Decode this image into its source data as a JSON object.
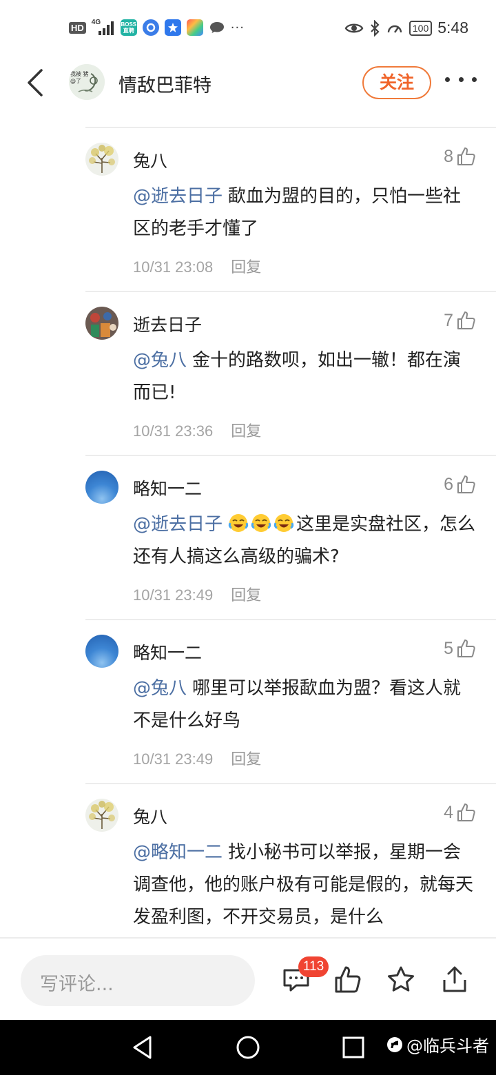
{
  "status_bar": {
    "hd": "HD",
    "network": "4G",
    "app_boss_line1": "BOSS",
    "app_boss_line2": "直聘",
    "time": "5:48",
    "battery": "100"
  },
  "header": {
    "author_name": "情敌巴菲特",
    "avatar_text": "我被 猪@了",
    "follow_label": "关注"
  },
  "comments": [
    {
      "author": "兔八",
      "likes": "8",
      "mention": "@逝去日子",
      "text": "歃血为盟的目的，只怕一些社区的老手才懂了",
      "time": "10/31 23:08",
      "reply": "回复"
    },
    {
      "author": "逝去日子",
      "likes": "7",
      "mention": "@兔八",
      "text": "金十的路数呗，如出一辙！都在演而已!",
      "time": "10/31 23:36",
      "reply": "回复"
    },
    {
      "author": "略知一二",
      "likes": "6",
      "mention": "@逝去日子",
      "text": "这里是实盘社区，怎么还有人搞这么高级的骗术?",
      "time": "10/31 23:49",
      "reply": "回复"
    },
    {
      "author": "略知一二",
      "likes": "5",
      "mention": "@兔八",
      "text": "哪里可以举报歃血为盟？看这人就不是什么好鸟",
      "time": "10/31 23:49",
      "reply": "回复"
    },
    {
      "author": "兔八",
      "likes": "4",
      "mention": "@略知一二",
      "text": "找小秘书可以举报，星期一会调查他，他的账户极有可能是假的，就每天发盈利图，不开交易员，是什么",
      "time": "",
      "reply": ""
    }
  ],
  "bottom_bar": {
    "placeholder": "写评论...",
    "comment_count": "113"
  },
  "watermark": "@临兵斗者",
  "colors": {
    "accent": "#f0642a",
    "mention": "#4c6fa3",
    "badge": "#f04432"
  }
}
